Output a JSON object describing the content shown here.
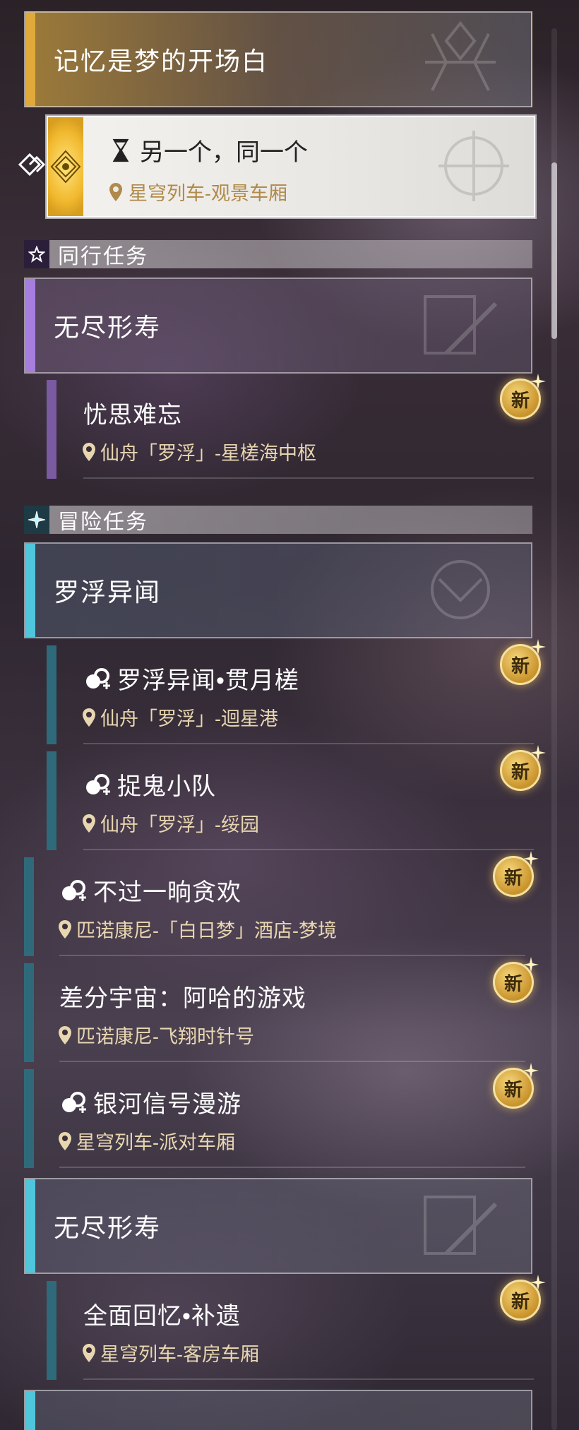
{
  "colors": {
    "main_accent": "#e0a93a",
    "companion_accent": "#a77de0",
    "adventure_accent": "#4fc6dc",
    "location_text": "#e8d6b0",
    "new_badge": "#e3b24d"
  },
  "main_group": {
    "title": "记忆是梦的开场白",
    "selected_quest": {
      "icon": "hourglass-icon",
      "title": "另一个，同一个",
      "location": "星穹列车-观景车厢"
    }
  },
  "companion": {
    "label": "同行任务",
    "icon": "star-icon",
    "group_title": "无尽形寿",
    "quests": [
      {
        "title": "忧思难忘",
        "location": "仙舟「罗浮」-星槎海中枢",
        "badge": "新"
      }
    ]
  },
  "adventure": {
    "label": "冒险任务",
    "icon": "sparkle-icon",
    "group_luofu": {
      "title": "罗浮异闻",
      "quests": [
        {
          "title": "罗浮异闻•贯月槎",
          "location": "仙舟「罗浮」-迴星港",
          "badge": "新"
        },
        {
          "title": "捉鬼小队",
          "location": "仙舟「罗浮」-绥园",
          "badge": "新"
        }
      ]
    },
    "loose_quests": [
      {
        "title": "不过一晌贪欢",
        "location": "匹诺康尼-「白日梦」酒店-梦境",
        "badge": "新"
      },
      {
        "title": "差分宇宙：阿哈的游戏",
        "location": "匹诺康尼-飞翔时针号",
        "badge": "新"
      },
      {
        "title": "银河信号漫游",
        "location": "星穹列车-派对车厢",
        "badge": "新"
      }
    ],
    "group_endless": {
      "title": "无尽形寿",
      "quests": [
        {
          "title": "全面回忆•补遗",
          "location": "星穹列车-客房车厢",
          "badge": "新"
        }
      ]
    }
  }
}
